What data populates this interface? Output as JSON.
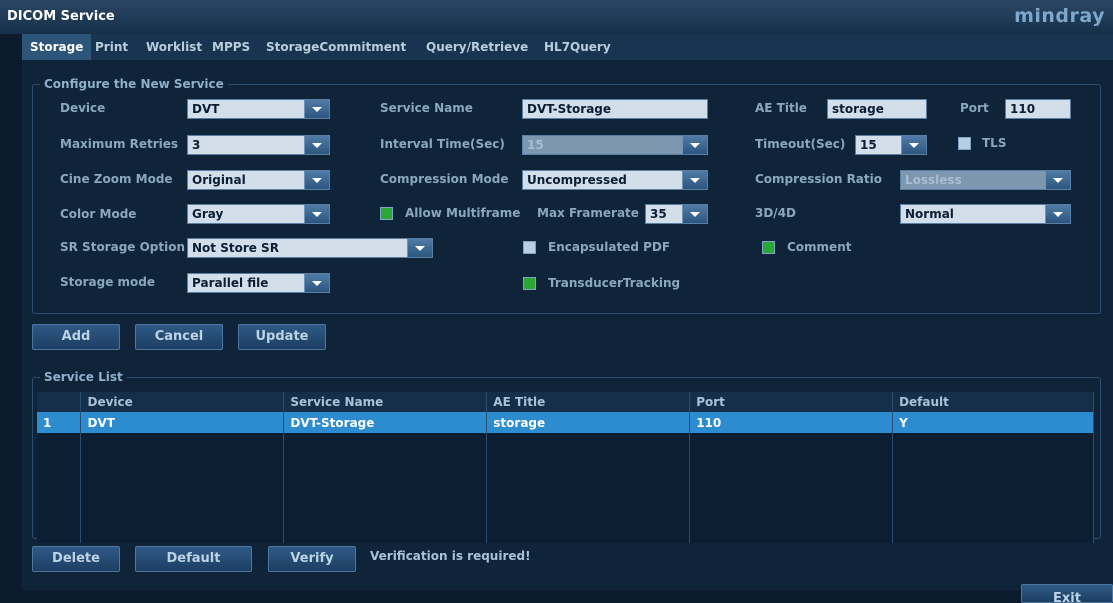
{
  "window": {
    "title": "DICOM Service",
    "logo": "mindray"
  },
  "tabs": [
    "Storage",
    "Print",
    "Worklist",
    "MPPS",
    "StorageCommitment",
    "Query/Retrieve",
    "HL7Query"
  ],
  "active_tab": "Storage",
  "config": {
    "legend": "Configure the New Service",
    "device_label": "Device",
    "device_value": "DVT",
    "service_name_label": "Service Name",
    "service_name_value": "DVT-Storage",
    "ae_title_label": "AE Title",
    "ae_title_value": "storage",
    "port_label": "Port",
    "port_value": "110",
    "max_retries_label": "Maximum Retries",
    "max_retries_value": "3",
    "interval_label": "Interval Time(Sec)",
    "interval_value": "15",
    "timeout_label": "Timeout(Sec)",
    "timeout_value": "15",
    "tls_label": "TLS",
    "cine_zoom_label": "Cine Zoom Mode",
    "cine_zoom_value": "Original",
    "compression_mode_label": "Compression Mode",
    "compression_mode_value": "Uncompressed",
    "compression_ratio_label": "Compression Ratio",
    "compression_ratio_value": "Lossless",
    "color_mode_label": "Color Mode",
    "color_mode_value": "Gray",
    "allow_multiframe_label": "Allow Multiframe",
    "max_framerate_label": "Max Framerate",
    "max_framerate_value": "35",
    "d3d4_label": "3D/4D",
    "d3d4_value": "Normal",
    "sr_label": "SR Storage Option",
    "sr_value": "Not Store SR",
    "encapsulated_pdf_label": "Encapsulated PDF",
    "comment_label": "Comment",
    "storage_mode_label": "Storage mode",
    "storage_mode_value": "Parallel file",
    "transducer_label": "TransducerTracking"
  },
  "actions": {
    "add": "Add",
    "cancel": "Cancel",
    "update": "Update"
  },
  "service_list": {
    "legend": "Service List",
    "columns": [
      "",
      "Device",
      "Service Name",
      "AE Title",
      "Port",
      "Default"
    ],
    "rows": [
      {
        "index": "1",
        "device": "DVT",
        "service_name": "DVT-Storage",
        "ae_title": "storage",
        "port": "110",
        "default": "Y"
      }
    ]
  },
  "bottom": {
    "delete": "Delete",
    "default": "Default",
    "verify": "Verify",
    "message": "Verification is required!",
    "exit": "Exit"
  },
  "colors": {
    "selected_row": "#2d8bd0",
    "checkbox_on": "#29a834"
  }
}
